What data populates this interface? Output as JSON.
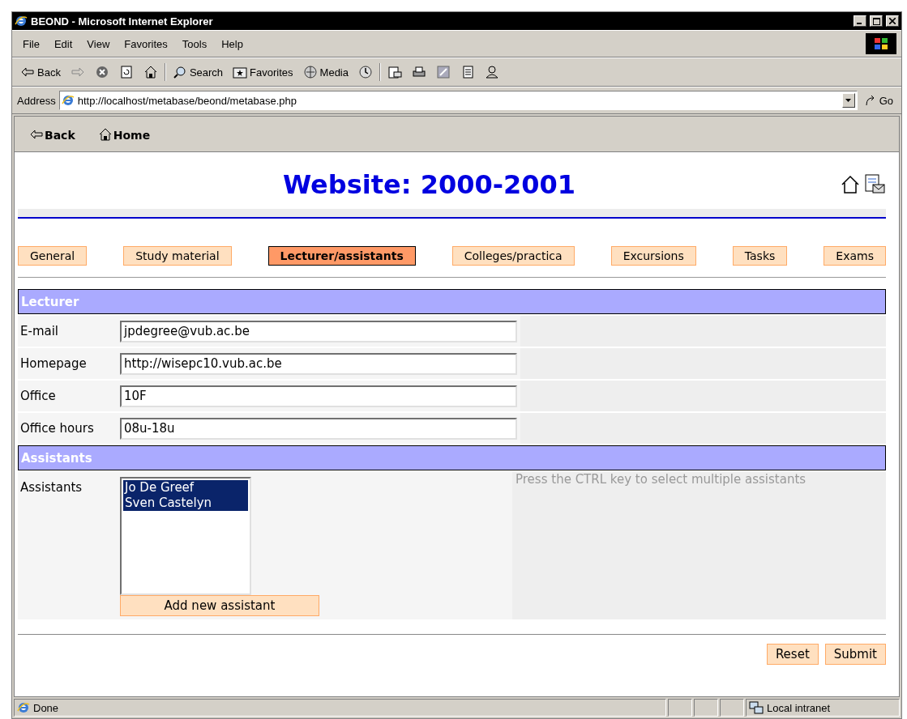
{
  "window": {
    "title": "BEOND - Microsoft Internet Explorer"
  },
  "menu": [
    "File",
    "Edit",
    "View",
    "Favorites",
    "Tools",
    "Help"
  ],
  "toolbar": [
    {
      "kind": "back",
      "label": "Back"
    },
    {
      "kind": "forward"
    },
    {
      "kind": "stop"
    },
    {
      "kind": "refresh"
    },
    {
      "kind": "home"
    },
    {
      "kind": "search",
      "label": "Search"
    },
    {
      "kind": "favorites",
      "label": "Favorites"
    },
    {
      "kind": "media",
      "label": "Media"
    },
    {
      "kind": "history"
    },
    {
      "kind": "mail"
    },
    {
      "kind": "print"
    },
    {
      "kind": "edit"
    },
    {
      "kind": "discuss"
    },
    {
      "kind": "messenger"
    }
  ],
  "address": {
    "label": "Address",
    "url": "http://localhost/metabase/beond/metabase.php",
    "go": "Go"
  },
  "page_nav": [
    {
      "kind": "back",
      "label": "Back"
    },
    {
      "kind": "home",
      "label": "Home"
    }
  ],
  "heading": "Website: 2000-2001",
  "tabs": [
    {
      "label": "General",
      "selected": false
    },
    {
      "label": "Study material",
      "selected": false
    },
    {
      "label": "Lecturer/assistants",
      "selected": true
    },
    {
      "label": "Colleges/practica",
      "selected": false
    },
    {
      "label": "Excursions",
      "selected": false
    },
    {
      "label": "Tasks",
      "selected": false
    },
    {
      "label": "Exams",
      "selected": false
    }
  ],
  "lecturer": {
    "title": "Lecturer",
    "fields": [
      {
        "label": "E-mail",
        "value": "jpdegree@vub.ac.be"
      },
      {
        "label": "Homepage",
        "value": "http://wisepc10.vub.ac.be"
      },
      {
        "label": "Office",
        "value": "10F"
      },
      {
        "label": "Office hours",
        "value": "08u-18u"
      }
    ]
  },
  "assistants": {
    "title": "Assistants",
    "label": "Assistants",
    "options": [
      {
        "label": "Jo De Greef",
        "selected": true
      },
      {
        "label": "Sven Castelyn",
        "selected": true
      }
    ],
    "add_button": "Add new assistant",
    "hint": "Press the CTRL key to select multiple assistants"
  },
  "buttons": [
    "Reset",
    "Submit"
  ],
  "status_bar": {
    "text": "Done",
    "zone": "Local intranet"
  }
}
